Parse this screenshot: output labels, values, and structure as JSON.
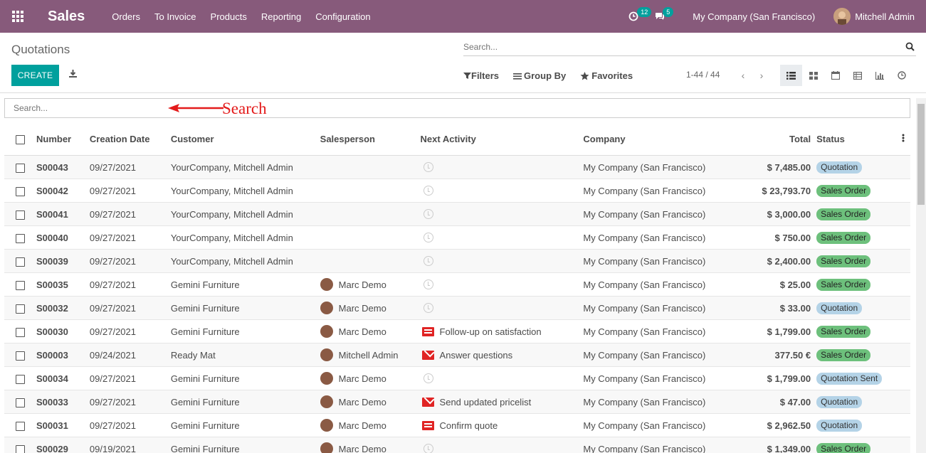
{
  "topbar": {
    "app_name": "Sales",
    "menu": [
      "Orders",
      "To Invoice",
      "Products",
      "Reporting",
      "Configuration"
    ],
    "activity_count": "12",
    "message_count": "5",
    "company": "My Company (San Francisco)",
    "user": "Mitchell Admin",
    "color": "#875a7b"
  },
  "control_panel": {
    "title": "Quotations",
    "search_placeholder": "Search...",
    "create_label": "CREATE",
    "filters_label": "Filters",
    "groupby_label": "Group By",
    "favorites_label": "Favorites",
    "pager": "1-44 / 44",
    "accent": "#00a09d"
  },
  "inline_search": {
    "placeholder": "Search...",
    "annotation": "Search"
  },
  "table": {
    "headers": {
      "number": "Number",
      "date": "Creation Date",
      "customer": "Customer",
      "salesperson": "Salesperson",
      "activity": "Next Activity",
      "company": "Company",
      "total": "Total",
      "status": "Status"
    },
    "rows": [
      {
        "number": "S00043",
        "date": "09/27/2021",
        "customer": "YourCompany, Mitchell Admin",
        "salesperson": "",
        "activity": "",
        "activity_icon": "clock-icon",
        "company": "My Company (San Francisco)",
        "total": "$ 7,485.00",
        "status": "Quotation",
        "status_type": "quote"
      },
      {
        "number": "S00042",
        "date": "09/27/2021",
        "customer": "YourCompany, Mitchell Admin",
        "salesperson": "",
        "activity": "",
        "activity_icon": "clock-icon",
        "company": "My Company (San Francisco)",
        "total": "$ 23,793.70",
        "status": "Sales Order",
        "status_type": "sale"
      },
      {
        "number": "S00041",
        "date": "09/27/2021",
        "customer": "YourCompany, Mitchell Admin",
        "salesperson": "",
        "activity": "",
        "activity_icon": "clock-icon",
        "company": "My Company (San Francisco)",
        "total": "$ 3,000.00",
        "status": "Sales Order",
        "status_type": "sale"
      },
      {
        "number": "S00040",
        "date": "09/27/2021",
        "customer": "YourCompany, Mitchell Admin",
        "salesperson": "",
        "activity": "",
        "activity_icon": "clock-icon",
        "company": "My Company (San Francisco)",
        "total": "$ 750.00",
        "status": "Sales Order",
        "status_type": "sale"
      },
      {
        "number": "S00039",
        "date": "09/27/2021",
        "customer": "YourCompany, Mitchell Admin",
        "salesperson": "",
        "activity": "",
        "activity_icon": "clock-icon",
        "company": "My Company (San Francisco)",
        "total": "$ 2,400.00",
        "status": "Sales Order",
        "status_type": "sale"
      },
      {
        "number": "S00035",
        "date": "09/27/2021",
        "customer": "Gemini Furniture",
        "salesperson": "Marc Demo",
        "activity": "",
        "activity_icon": "clock-icon",
        "company": "My Company (San Francisco)",
        "total": "$ 25.00",
        "status": "Sales Order",
        "status_type": "sale"
      },
      {
        "number": "S00032",
        "date": "09/27/2021",
        "customer": "Gemini Furniture",
        "salesperson": "Marc Demo",
        "activity": "",
        "activity_icon": "clock-icon",
        "company": "My Company (San Francisco)",
        "total": "$ 33.00",
        "status": "Quotation",
        "status_type": "quote"
      },
      {
        "number": "S00030",
        "date": "09/27/2021",
        "customer": "Gemini Furniture",
        "salesperson": "Marc Demo",
        "activity": "Follow-up on satisfaction",
        "activity_icon": "task-icon",
        "company": "My Company (San Francisco)",
        "total": "$ 1,799.00",
        "status": "Sales Order",
        "status_type": "sale"
      },
      {
        "number": "S00003",
        "date": "09/24/2021",
        "customer": "Ready Mat",
        "salesperson": "Mitchell Admin",
        "activity": "Answer questions",
        "activity_icon": "mail-icon",
        "company": "My Company (San Francisco)",
        "total": "377.50 €",
        "status": "Sales Order",
        "status_type": "sale"
      },
      {
        "number": "S00034",
        "date": "09/27/2021",
        "customer": "Gemini Furniture",
        "salesperson": "Marc Demo",
        "activity": "",
        "activity_icon": "clock-icon",
        "company": "My Company (San Francisco)",
        "total": "$ 1,799.00",
        "status": "Quotation Sent",
        "status_type": "quote"
      },
      {
        "number": "S00033",
        "date": "09/27/2021",
        "customer": "Gemini Furniture",
        "salesperson": "Marc Demo",
        "activity": "Send updated pricelist",
        "activity_icon": "mail-icon",
        "company": "My Company (San Francisco)",
        "total": "$ 47.00",
        "status": "Quotation",
        "status_type": "quote"
      },
      {
        "number": "S00031",
        "date": "09/27/2021",
        "customer": "Gemini Furniture",
        "salesperson": "Marc Demo",
        "activity": "Confirm quote",
        "activity_icon": "task-icon",
        "company": "My Company (San Francisco)",
        "total": "$ 2,962.50",
        "status": "Quotation",
        "status_type": "quote"
      },
      {
        "number": "S00029",
        "date": "09/19/2021",
        "customer": "Gemini Furniture",
        "salesperson": "Marc Demo",
        "activity": "",
        "activity_icon": "clock-icon",
        "company": "My Company (San Francisco)",
        "total": "$ 1,349.00",
        "status": "Sales Order",
        "status_type": "sale"
      }
    ]
  }
}
